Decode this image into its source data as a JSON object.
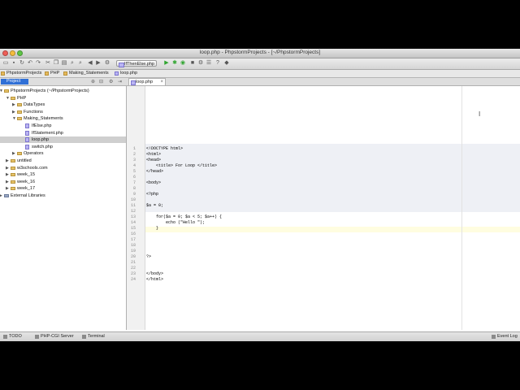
{
  "window": {
    "title": "loop.php - PhpstormProjects - [~/PhpstormProjects]"
  },
  "toolbar": {
    "run_config": "IfThenElse.php"
  },
  "breadcrumb": [
    "PhpstormProjects",
    "PHP",
    "Making_Statements",
    "loop.php"
  ],
  "project_panel": {
    "label": "Project"
  },
  "editor_tab": {
    "label": "loop.php"
  },
  "tree": [
    {
      "label": "PhpstormProjects (~/PhpstormProjects)",
      "kind": "root"
    },
    {
      "label": "PHP",
      "kind": "folder"
    },
    {
      "label": "DataTypes",
      "kind": "folder"
    },
    {
      "label": "Functions",
      "kind": "folder"
    },
    {
      "label": "Making_Statements",
      "kind": "folder"
    },
    {
      "label": "IfElse.php",
      "kind": "file"
    },
    {
      "label": "IfStatement.php",
      "kind": "file"
    },
    {
      "label": "loop.php",
      "kind": "file",
      "selected": true
    },
    {
      "label": "switch.php",
      "kind": "file"
    },
    {
      "label": "Operators",
      "kind": "folder"
    },
    {
      "label": "untitled",
      "kind": "folder"
    },
    {
      "label": "w3schools.com",
      "kind": "folder"
    },
    {
      "label": "week_15",
      "kind": "folder"
    },
    {
      "label": "week_16",
      "kind": "folder"
    },
    {
      "label": "week_17",
      "kind": "folder"
    },
    {
      "label": "External Libraries",
      "kind": "lib"
    }
  ],
  "code": [
    {
      "n": "1",
      "text": "<!DOCTYPE html>"
    },
    {
      "n": "2",
      "text": "<html>"
    },
    {
      "n": "3",
      "text": "<head>"
    },
    {
      "n": "4",
      "text": "    <title> For Loop </title>"
    },
    {
      "n": "5",
      "text": "</head>"
    },
    {
      "n": "6",
      "text": ""
    },
    {
      "n": "7",
      "text": "<body>"
    },
    {
      "n": "8",
      "text": ""
    },
    {
      "n": "9",
      "text": "<?php"
    },
    {
      "n": "10",
      "text": ""
    },
    {
      "n": "11",
      "text": "$a = 0;"
    },
    {
      "n": "12",
      "text": ""
    },
    {
      "n": "13",
      "text": "    for($a = 0; $a < 5; $a++) {"
    },
    {
      "n": "14",
      "text": "        echo (\"Hello \");"
    },
    {
      "n": "15",
      "text": "    }"
    },
    {
      "n": "16",
      "text": ""
    },
    {
      "n": "17",
      "text": ""
    },
    {
      "n": "18",
      "text": ""
    },
    {
      "n": "19",
      "text": ""
    },
    {
      "n": "20",
      "text": "?>"
    },
    {
      "n": "21",
      "text": ""
    },
    {
      "n": "22",
      "text": ""
    },
    {
      "n": "23",
      "text": "</body>"
    },
    {
      "n": "24",
      "text": "</html>"
    }
  ],
  "statusbar": {
    "todo": "TODO",
    "php_server": "PHP-CGI Server",
    "terminal": "Terminal",
    "event_log": "Event Log"
  },
  "colors": {
    "selection": "#2f6fd6",
    "php_block": "#eef0f5",
    "current_line": "#fffde0"
  }
}
